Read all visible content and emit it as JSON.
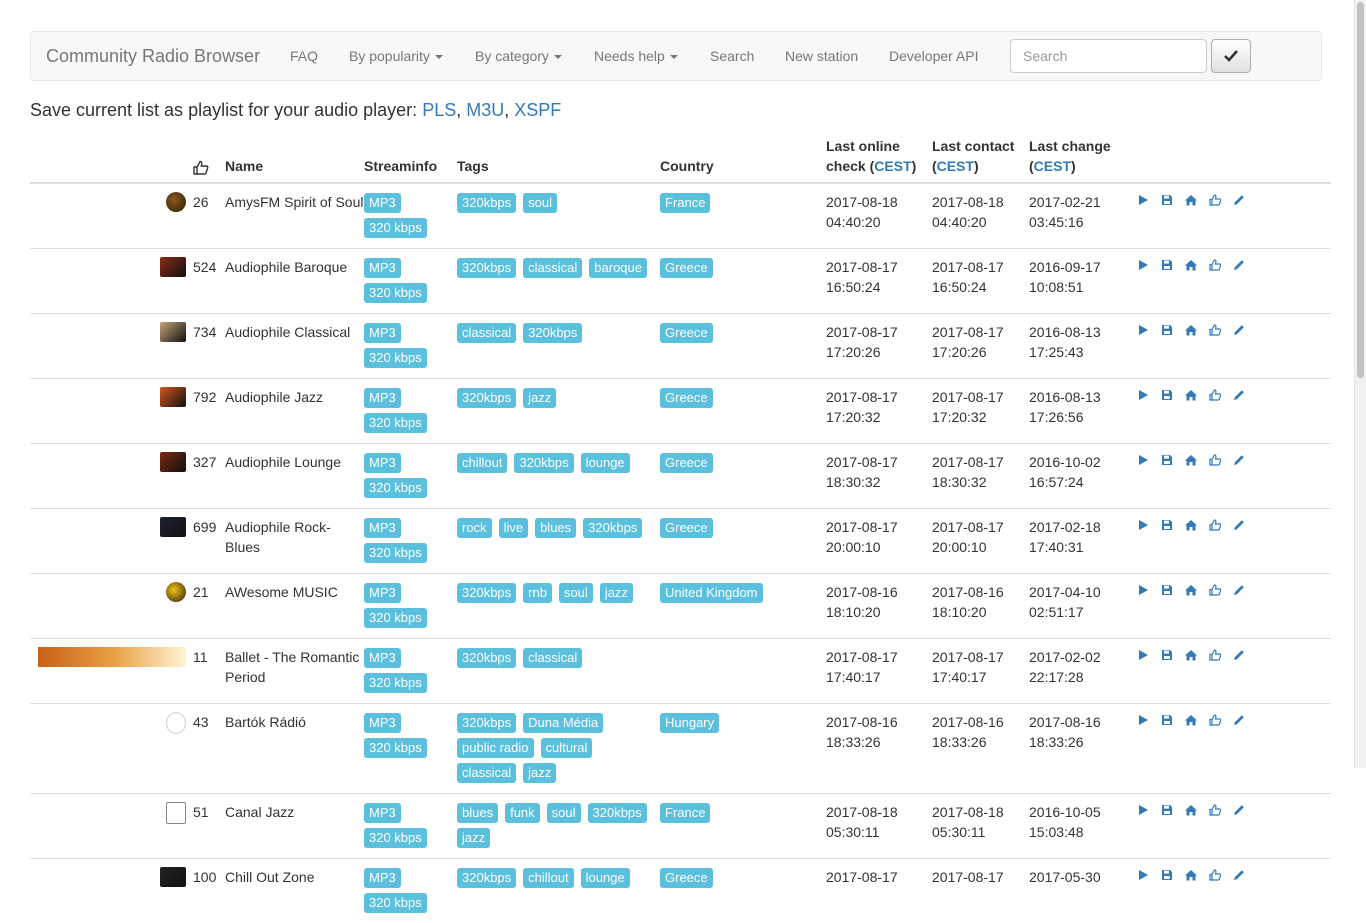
{
  "navbar": {
    "brand": "Community Radio Browser",
    "items": [
      {
        "label": "FAQ",
        "dropdown": false
      },
      {
        "label": "By popularity",
        "dropdown": true
      },
      {
        "label": "By category",
        "dropdown": true
      },
      {
        "label": "Needs help",
        "dropdown": true
      },
      {
        "label": "Search",
        "dropdown": false
      },
      {
        "label": "New station",
        "dropdown": false
      },
      {
        "label": "Developer API",
        "dropdown": false
      }
    ],
    "search_placeholder": "Search",
    "submit_icon": "checkmark-icon"
  },
  "playlist": {
    "text": "Save current list as playlist for your audio player:",
    "formats": [
      "PLS",
      "M3U",
      "XSPF"
    ]
  },
  "table": {
    "headers": {
      "votes_icon": "thumbs-up-icon",
      "name": "Name",
      "streaminfo": "Streaminfo",
      "tags": "Tags",
      "country": "Country",
      "last_check": "Last online check",
      "last_contact": "Last contact",
      "last_change": "Last change",
      "tz": "CEST"
    },
    "action_icons": [
      "play-icon",
      "save-icon",
      "home-icon",
      "vote-icon",
      "edit-icon"
    ],
    "rows": [
      {
        "votes": "26",
        "name": "AmysFM Spirit of Soul",
        "stream": [
          "MP3",
          "320 kbps"
        ],
        "tags": [
          "320kbps",
          "soul"
        ],
        "country": "France",
        "check": [
          "2017-08-18",
          "04:40:20"
        ],
        "contact": [
          "2017-08-18",
          "04:40:20"
        ],
        "change": [
          "2017-02-21",
          "03:45:16"
        ],
        "thumb": "round",
        "color": "#8a5a1a"
      },
      {
        "votes": "524",
        "name": "Audiophile Baroque",
        "stream": [
          "MP3",
          "320 kbps"
        ],
        "tags": [
          "320kbps",
          "classical",
          "baroque"
        ],
        "country": "Greece",
        "check": [
          "2017-08-17",
          "16:50:24"
        ],
        "contact": [
          "2017-08-17",
          "16:50:24"
        ],
        "change": [
          "2016-09-17",
          "10:08:51"
        ],
        "thumb": "rect",
        "color": "#8b2a1a"
      },
      {
        "votes": "734",
        "name": "Audiophile Classical",
        "stream": [
          "MP3",
          "320 kbps"
        ],
        "tags": [
          "classical",
          "320kbps"
        ],
        "country": "Greece",
        "check": [
          "2017-08-17",
          "17:20:26"
        ],
        "contact": [
          "2017-08-17",
          "17:20:26"
        ],
        "change": [
          "2016-08-13",
          "17:25:43"
        ],
        "thumb": "rect",
        "color": "#c4a37a"
      },
      {
        "votes": "792",
        "name": "Audiophile Jazz",
        "stream": [
          "MP3",
          "320 kbps"
        ],
        "tags": [
          "320kbps",
          "jazz"
        ],
        "country": "Greece",
        "check": [
          "2017-08-17",
          "17:20:32"
        ],
        "contact": [
          "2017-08-17",
          "17:20:32"
        ],
        "change": [
          "2016-08-13",
          "17:26:56"
        ],
        "thumb": "rect",
        "color": "#d0581c"
      },
      {
        "votes": "327",
        "name": "Audiophile Lounge",
        "stream": [
          "MP3",
          "320 kbps"
        ],
        "tags": [
          "chillout",
          "320kbps",
          "lounge"
        ],
        "country": "Greece",
        "check": [
          "2017-08-17",
          "18:30:32"
        ],
        "contact": [
          "2017-08-17",
          "18:30:32"
        ],
        "change": [
          "2016-10-02",
          "16:57:24"
        ],
        "thumb": "rect",
        "color": "#7a2a10"
      },
      {
        "votes": "699",
        "name": "Audiophile Rock-Blues",
        "stream": [
          "MP3",
          "320 kbps"
        ],
        "tags": [
          "rock",
          "live",
          "blues",
          "320kbps"
        ],
        "country": "Greece",
        "check": [
          "2017-08-17",
          "20:00:10"
        ],
        "contact": [
          "2017-08-17",
          "20:00:10"
        ],
        "change": [
          "2017-02-18",
          "17:40:31"
        ],
        "thumb": "rect",
        "color": "#1c2233"
      },
      {
        "votes": "21",
        "name": "AWesome MUSIC",
        "stream": [
          "MP3",
          "320 kbps"
        ],
        "tags": [
          "320kbps",
          "rnb",
          "soul",
          "jazz"
        ],
        "country": "United Kingdom",
        "check": [
          "2017-08-16",
          "18:10:20"
        ],
        "contact": [
          "2017-08-16",
          "18:10:20"
        ],
        "change": [
          "2017-04-10",
          "02:51:17"
        ],
        "thumb": "round",
        "color": "#f2c21a"
      },
      {
        "votes": "11",
        "name": "Ballet - The Romantic Period",
        "stream": [
          "MP3",
          "320 kbps"
        ],
        "tags": [
          "320kbps",
          "classical"
        ],
        "country": "",
        "check": [
          "2017-08-17",
          "17:40:17"
        ],
        "contact": [
          "2017-08-17",
          "17:40:17"
        ],
        "change": [
          "2017-02-02",
          "22:17:28"
        ],
        "thumb": "wide",
        "color": "#e8a040"
      },
      {
        "votes": "43",
        "name": "Bartók Rádió",
        "stream": [
          "MP3",
          "320 kbps"
        ],
        "tags": [
          "320kbps",
          "Duna Média",
          "public radio",
          "cultural",
          "classical",
          "jazz"
        ],
        "country": "Hungary",
        "check": [
          "2017-08-16",
          "18:33:26"
        ],
        "contact": [
          "2017-08-16",
          "18:33:26"
        ],
        "change": [
          "2017-08-16",
          "18:33:26"
        ],
        "thumb": "logo",
        "color": "#ffffff"
      },
      {
        "votes": "51",
        "name": "Canal Jazz",
        "stream": [
          "MP3",
          "320 kbps"
        ],
        "tags": [
          "blues",
          "funk",
          "soul",
          "320kbps",
          "jazz"
        ],
        "country": "France",
        "check": [
          "2017-08-18",
          "05:30:11"
        ],
        "contact": [
          "2017-08-18",
          "05:30:11"
        ],
        "change": [
          "2016-10-05",
          "15:03:48"
        ],
        "thumb": "box",
        "color": "#ffffff"
      },
      {
        "votes": "100",
        "name": "Chill Out Zone",
        "stream": [
          "MP3",
          "320 kbps"
        ],
        "tags": [
          "320kbps",
          "chillout",
          "lounge"
        ],
        "country": "Greece",
        "check": [
          "2017-08-17",
          ""
        ],
        "contact": [
          "2017-08-17",
          ""
        ],
        "change": [
          "2017-05-30",
          ""
        ],
        "thumb": "rect",
        "color": "#222222"
      }
    ]
  }
}
